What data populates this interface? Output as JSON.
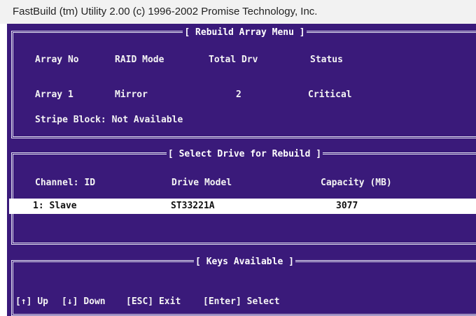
{
  "window": {
    "title": "FastBuild (tm) Utility 2.00 (c) 1996-2002 Promise Technology, Inc."
  },
  "rebuild_menu": {
    "title": "[ Rebuild Array Menu ]",
    "headers": {
      "array_no": "Array No",
      "raid_mode": "RAID Mode",
      "total_drv": "Total Drv",
      "status": "Status"
    },
    "row": {
      "array_no": "Array 1",
      "raid_mode": "Mirror",
      "total_drv": "2",
      "status": "Critical"
    },
    "stripe_block": "Stripe Block: Not Available"
  },
  "select_drive": {
    "title": "[ Select Drive for Rebuild ]",
    "headers": {
      "channel": "Channel: ID",
      "drive_model": "Drive Model",
      "capacity": "Capacity (MB)"
    },
    "rows": [
      {
        "channel": "1: Slave",
        "drive_model": "ST33221A",
        "capacity": "3077"
      }
    ]
  },
  "keys": {
    "title": "[ Keys Available ]",
    "items": [
      {
        "key": "[↑]",
        "label": "Up"
      },
      {
        "key": "[↓]",
        "label": "Down"
      },
      {
        "key": "[ESC]",
        "label": "Exit"
      },
      {
        "key": "[Enter]",
        "label": "Select"
      }
    ]
  },
  "colors": {
    "background": "#3a1a7a",
    "text": "#f4f4f4",
    "highlight": "#ffffff"
  }
}
